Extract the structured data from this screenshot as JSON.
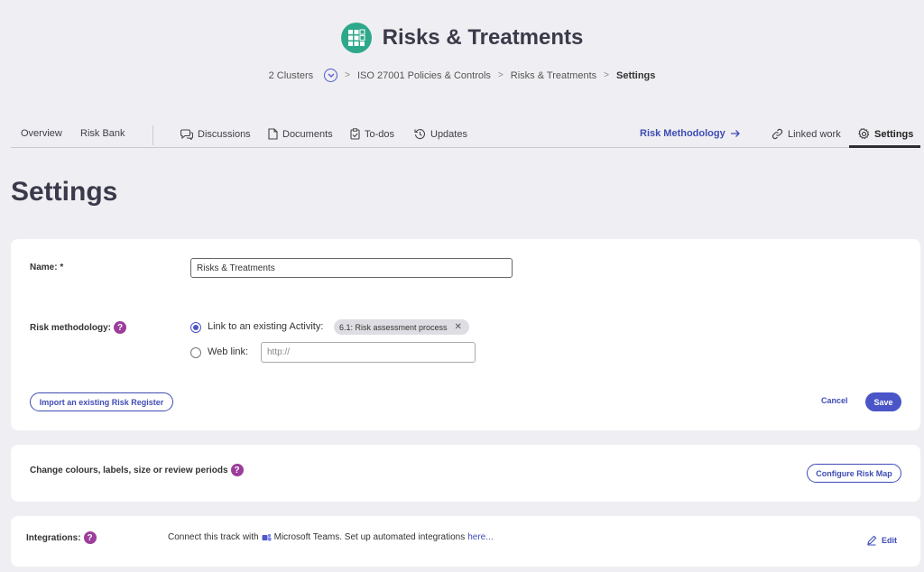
{
  "header": {
    "title": "Risks & Treatments",
    "logo_icon": "grid-icon",
    "logo_color": "#2ea88a"
  },
  "breadcrumb": {
    "items": [
      "2 Clusters",
      "ISO 27001 Policies & Controls",
      "Risks & Treatments"
    ],
    "current": "Settings",
    "separator": ">"
  },
  "tabs": {
    "overview": "Overview",
    "risk_bank": "Risk Bank",
    "discussions": "Discussions",
    "documents": "Documents",
    "todos": "To-dos",
    "updates": "Updates",
    "risk_methodology": "Risk Methodology",
    "linked_work": "Linked work",
    "settings": "Settings"
  },
  "page": {
    "title": "Settings"
  },
  "settings_form": {
    "name_label": "Name: *",
    "name_value": "Risks & Treatments",
    "risk_methodology_label": "Risk methodology:",
    "help_glyph": "?",
    "option_activity_label": "Link to an existing Activity:",
    "activity_chip": "6.1: Risk assessment process",
    "chip_remove": "✕",
    "option_web_label": "Web link:",
    "web_link_placeholder": "http://",
    "import_button": "Import an existing Risk Register",
    "cancel_button": "Cancel",
    "save_button": "Save"
  },
  "risk_map": {
    "label": "Change colours, labels, size or review periods",
    "configure_button": "Configure Risk Map"
  },
  "integrations": {
    "label": "Integrations:",
    "text_prefix": "Connect this track with",
    "teams_name": "Microsoft Teams. Set up automated integrations",
    "link_text": "here...",
    "edit_button": "Edit"
  },
  "colors": {
    "accent": "#4a55c8",
    "link": "#3f4cb4",
    "help": "#9b3d9b",
    "background": "#efeff3"
  }
}
